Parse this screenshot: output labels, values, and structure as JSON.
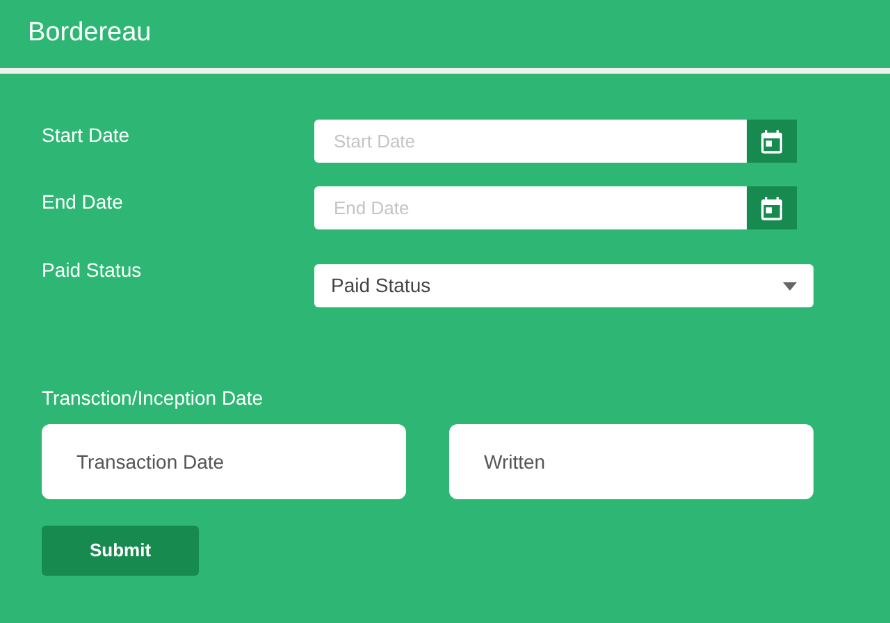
{
  "header": {
    "title": "Bordereau"
  },
  "date_fields": [
    {
      "label": "Start Date",
      "placeholder": "Start Date"
    },
    {
      "label": "End Date",
      "placeholder": "End Date"
    }
  ],
  "paid_status": {
    "label": "Paid Status",
    "value": "Paid Status"
  },
  "date_type": {
    "label": "Transction/Inception Date",
    "options": [
      "Transaction Date",
      "Written"
    ]
  },
  "submit": "Submit"
}
